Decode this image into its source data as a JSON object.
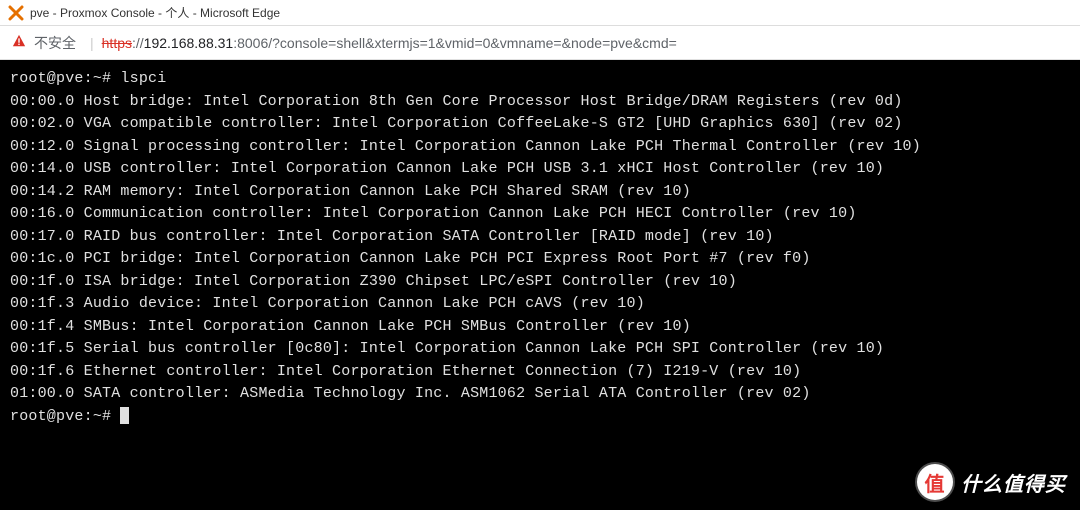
{
  "window": {
    "title": "pve - Proxmox Console - 个人 - Microsoft Edge",
    "app_icon_glyph": "✕"
  },
  "address": {
    "insecure_label": "不安全",
    "warn_glyph": "▲",
    "separator": "|",
    "scheme": "https",
    "scheme_sep": "://",
    "host": "192.168.88.31",
    "port_path": ":8006/?console=shell&xtermjs=1&vmid=0&vmname=&node=pve&cmd="
  },
  "terminal": {
    "prompt": "root@pve:~#",
    "command": "lspci",
    "lines": [
      "00:00.0 Host bridge: Intel Corporation 8th Gen Core Processor Host Bridge/DRAM Registers (rev 0d)",
      "00:02.0 VGA compatible controller: Intel Corporation CoffeeLake-S GT2 [UHD Graphics 630] (rev 02)",
      "00:12.0 Signal processing controller: Intel Corporation Cannon Lake PCH Thermal Controller (rev 10)",
      "00:14.0 USB controller: Intel Corporation Cannon Lake PCH USB 3.1 xHCI Host Controller (rev 10)",
      "00:14.2 RAM memory: Intel Corporation Cannon Lake PCH Shared SRAM (rev 10)",
      "00:16.0 Communication controller: Intel Corporation Cannon Lake PCH HECI Controller (rev 10)",
      "00:17.0 RAID bus controller: Intel Corporation SATA Controller [RAID mode] (rev 10)",
      "00:1c.0 PCI bridge: Intel Corporation Cannon Lake PCH PCI Express Root Port #7 (rev f0)",
      "00:1f.0 ISA bridge: Intel Corporation Z390 Chipset LPC/eSPI Controller (rev 10)",
      "00:1f.3 Audio device: Intel Corporation Cannon Lake PCH cAVS (rev 10)",
      "00:1f.4 SMBus: Intel Corporation Cannon Lake PCH SMBus Controller (rev 10)",
      "00:1f.5 Serial bus controller [0c80]: Intel Corporation Cannon Lake PCH SPI Controller (rev 10)",
      "00:1f.6 Ethernet controller: Intel Corporation Ethernet Connection (7) I219-V (rev 10)",
      "01:00.0 SATA controller: ASMedia Technology Inc. ASM1062 Serial ATA Controller (rev 02)"
    ],
    "prompt2": "root@pve:~#"
  },
  "watermark": {
    "badge_char": "值",
    "text": "什么值得买"
  }
}
